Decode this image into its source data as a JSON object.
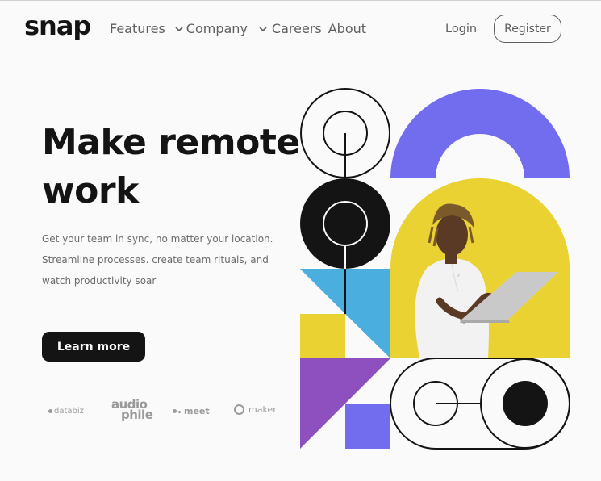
{
  "brand": {
    "logo": "snap"
  },
  "nav": {
    "features": "Features",
    "company": "Company",
    "careers": "Careers",
    "about": "About"
  },
  "auth": {
    "login": "Login",
    "register": "Register"
  },
  "hero": {
    "title": "Make remote work",
    "text": "Get your team in sync, no matter your location. Streamline processes. create team rituals, and watch productivity soar",
    "cta": "Learn more"
  },
  "clients": {
    "databiz": "databiz",
    "audiophile_1": "audio",
    "audiophile_2": "phile",
    "meet": "meet",
    "maker": "maker"
  },
  "colors": {
    "text": "#141414",
    "muted": "#6b6b6b",
    "purple": "#726cee",
    "blue": "#4aaede",
    "yellow": "#ead233",
    "violet": "#8e4fbf"
  },
  "icons": {
    "chevron": "chevron-down-icon",
    "hero_art": "geometric-illustration"
  }
}
